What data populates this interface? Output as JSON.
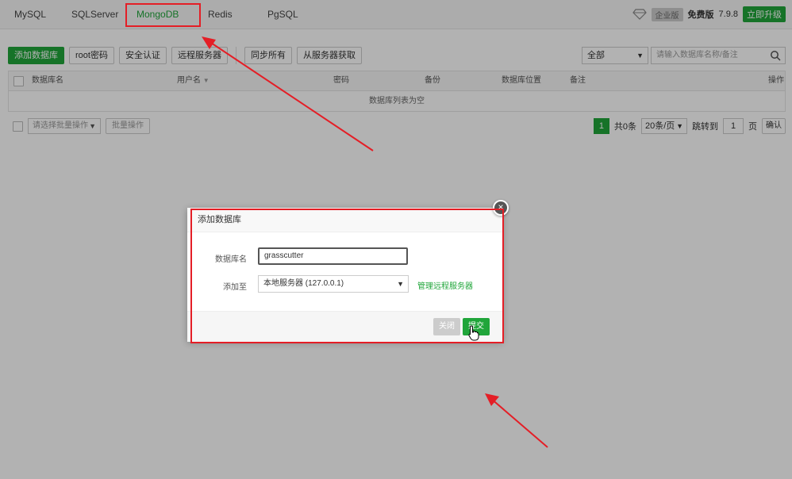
{
  "tabs": [
    {
      "label": "MySQL"
    },
    {
      "label": "SQLServer"
    },
    {
      "label": "MongoDB",
      "active": true
    },
    {
      "label": "Redis"
    },
    {
      "label": "PgSQL"
    }
  ],
  "header": {
    "enterprise_label": "企业版",
    "free_label": "免费版",
    "version": "7.9.8",
    "upgrade_label": "立即升级"
  },
  "toolbar": {
    "add_db": "添加数据库",
    "root_pwd": "root密码",
    "security": "安全认证",
    "remote": "远程服务器",
    "sync_all": "同步所有",
    "fetch": "从服务器获取"
  },
  "filter": {
    "selected": "全部",
    "search_placeholder": "请输入数据库名称/备注"
  },
  "table": {
    "headers": {
      "name": "数据库名",
      "user": "用户名",
      "pwd": "密码",
      "backup": "备份",
      "location": "数据库位置",
      "remark": "备注",
      "action": "操作"
    },
    "empty_text": "数据库列表为空"
  },
  "footer": {
    "batch_placeholder": "请选择批量操作",
    "batch_btn": "批量操作",
    "page_current": "1",
    "total": "共0条",
    "per_page": "20条/页",
    "goto_label": "跳转到",
    "goto_value": "1",
    "page_unit": "页",
    "confirm": "确认"
  },
  "modal": {
    "title": "添加数据库",
    "name_label": "数据库名",
    "name_value": "grasscutter",
    "add_to_label": "添加至",
    "server_value": "本地服务器 (127.0.0.1)",
    "manage_link": "管理远程服务器",
    "close_btn": "关闭",
    "submit_btn": "提交"
  },
  "colors": {
    "accent": "#20a53a",
    "annotation": "#e41e26"
  }
}
